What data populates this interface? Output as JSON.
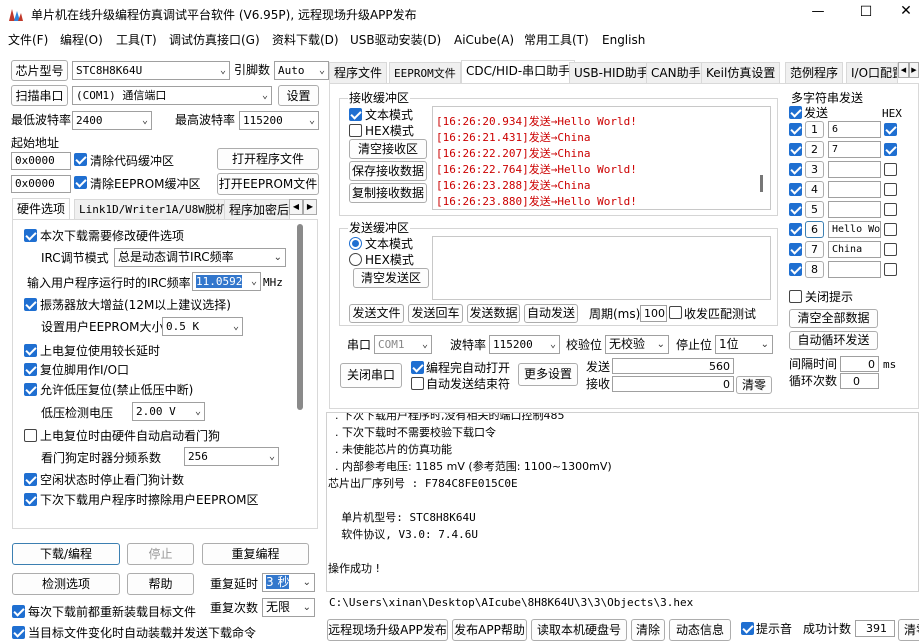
{
  "window": {
    "title": "单片机在线升级编程仿真调试平台软件 (V6.95P), 远程现场升级APP发布",
    "controls": [
      "—",
      "☐",
      "✕"
    ]
  },
  "menu": [
    "文件(F)",
    "编程(O)",
    "工具(T)",
    "调试仿真接口(G)",
    "资料下载(D)",
    "USB驱动安装(D)",
    "AiCube(A)",
    "常用工具(T)",
    "English"
  ],
  "left": {
    "chip_label": "芯片型号",
    "chip_value": "STC8H8K64U",
    "pin_label": "引脚数",
    "pin_value": "Auto",
    "scan_button": "扫描串口",
    "com_value": "(COM1) 通信端口",
    "settings_button": "设置",
    "min_baud_label": "最低波特率",
    "min_baud_value": "2400",
    "max_baud_label": "最高波特率",
    "max_baud_value": "115200",
    "start_addr_label": "起始地址",
    "addr1": "0x0000",
    "clear_code_label": "清除代码缓冲区",
    "open_prog_button": "打开程序文件",
    "addr2": "0x0000",
    "clear_eeprom_label": "清除EEPROM缓冲区",
    "open_eeprom_button": "打开EEPROM文件",
    "tabs": [
      "硬件选项",
      "Link1D/Writer1A/U8W脱机",
      "程序加密后"
    ],
    "hw": {
      "opt1": "本次下载需要修改硬件选项",
      "irc_mode_label": "IRC调节模式",
      "irc_mode_value": "总是动态调节IRC频率",
      "irc_freq_label": "输入用户程序运行时的IRC频率",
      "irc_freq_value": "11.0592",
      "irc_unit": "MHz",
      "opt2": "振荡器放大增益(12M以上建议选择)",
      "eeprom_size_label": "设置用户EEPROM大小",
      "eeprom_size_value": "0.5 K",
      "opt3": "上电复位使用较长延时",
      "opt4": "复位脚用作I/O口",
      "opt5": "允许低压复位(禁止低压中断)",
      "lvd_label": "低压检测电压",
      "lvd_value": "2.00 V",
      "opt6": "上电复位时由硬件自动启动看门狗",
      "wdt_label": "看门狗定时器分频系数",
      "wdt_value": "256",
      "opt7": "空闲状态时停止看门狗计数",
      "opt8": "下次下载用户程序时擦除用户EEPROM区"
    },
    "download_button": "下载/编程",
    "stop_button": "停止",
    "repeat_button": "重复编程",
    "detect_button": "检测选项",
    "help_button": "帮助",
    "repeat_delay_label": "重复延时",
    "repeat_delay_value": "3 秒",
    "reload_label": "每次下载前都重新装载目标文件",
    "repeat_count_label": "重复次数",
    "repeat_count_value": "无限",
    "autosend_label": "当目标文件变化时自动装载并发送下载命令"
  },
  "right_tabs": [
    "程序文件",
    "EEPROM文件",
    "CDC/HID-串口助手",
    "USB-HID助手",
    "CAN助手",
    "Keil仿真设置",
    "范例程序",
    "I/O口配置"
  ],
  "recv": {
    "group_label": "接收缓冲区",
    "text_mode": "文本模式",
    "hex_mode": "HEX模式",
    "clear_button": "清空接收区",
    "save_button": "保存接收数据",
    "copy_button": "复制接收数据",
    "lines": [
      {
        "time": "[16:26:20.934]",
        "dir": "发送→",
        "msg": "Hello World!"
      },
      {
        "time": "[16:26:21.431]",
        "dir": "发送→",
        "msg": "China"
      },
      {
        "time": "[16:26:22.207]",
        "dir": "发送→",
        "msg": "China"
      },
      {
        "time": "[16:26:22.764]",
        "dir": "发送→",
        "msg": "Hello World!"
      },
      {
        "time": "[16:26:23.288]",
        "dir": "发送→",
        "msg": "China"
      },
      {
        "time": "[16:26:23.880]",
        "dir": "发送→",
        "msg": "Hello World!"
      }
    ]
  },
  "send": {
    "group_label": "发送缓冲区",
    "text_mode": "文本模式",
    "hex_mode": "HEX模式",
    "clear_button": "清空发送区",
    "send_file": "发送文件",
    "send_enter": "发送回车",
    "send_data": "发送数据",
    "auto_send": "自动发送",
    "period_label": "周期(ms)",
    "period_value": "100",
    "match_label": "收发匹配测试"
  },
  "multi": {
    "title": "多字符串发送",
    "send_col": "发送",
    "hex_col": "HEX",
    "rows": [
      {
        "n": "1",
        "text": "6",
        "hex": true
      },
      {
        "n": "2",
        "text": "7",
        "hex": true
      },
      {
        "n": "3",
        "text": "",
        "hex": false
      },
      {
        "n": "4",
        "text": "",
        "hex": false
      },
      {
        "n": "5",
        "text": "",
        "hex": false
      },
      {
        "n": "6",
        "text": "Hello Wo",
        "hex": false
      },
      {
        "n": "7",
        "text": "China",
        "hex": false
      },
      {
        "n": "8",
        "text": "",
        "hex": false
      }
    ],
    "close_hint": "关闭提示",
    "clear_all": "清空全部数据",
    "auto_loop": "自动循环发送",
    "interval_label": "间隔时间",
    "interval_value": "0",
    "interval_unit": "ms",
    "loop_label": "循环次数",
    "loop_value": "0"
  },
  "serial": {
    "port_label": "串口",
    "port_value": "COM1",
    "baud_label": "波特率",
    "baud_value": "115200",
    "parity_label": "校验位",
    "parity_value": "无校验",
    "stop_label": "停止位",
    "stop_value": "1位",
    "close_port": "关闭串口",
    "auto_open": "编程完自动打开",
    "auto_end": "自动发送结束符",
    "more": "更多设置",
    "send_label": "发送",
    "send_count": "560",
    "recv_label": "接收",
    "recv_count": "0",
    "clear_button": "清零"
  },
  "log": {
    "lines": [
      "  . 下次下载用户程序时,没有相关的端口控制485",
      "  . 下次下载时不需要校验下载口令",
      "  . 未使能芯片的仿真功能",
      "  . 内部参考电压: 1185 mV (参考范围: 1100~1300mV)",
      "芯片出厂序列号 : F784C8FE015C0E",
      "",
      "  单片机型号: STC8H8K64U",
      "  软件协议, V3.0: 7.4.6U",
      "",
      "操作成功 !"
    ]
  },
  "path": "C:\\Users\\xinan\\Desktop\\AIcube\\8H8K64U\\3\\3\\Objects\\3.hex",
  "bottom": {
    "publish": "远程现场升级APP发布",
    "publish_help": "发布APP帮助",
    "read_disk": "读取本机硬盘号",
    "clear": "清除",
    "dynamic": "动态信息",
    "tip_sound": "提示音",
    "success_label": "成功计数",
    "success_value": "391",
    "clear_zero": "清零"
  }
}
